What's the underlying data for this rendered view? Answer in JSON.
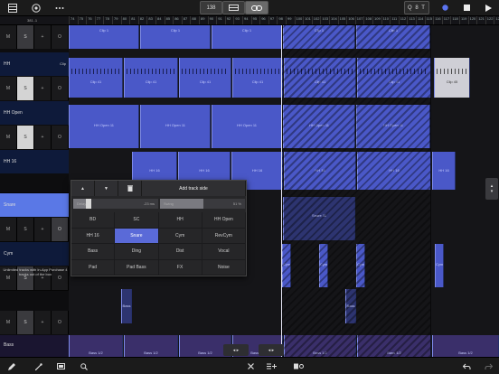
{
  "topbar": {
    "tempo": "138",
    "quantize_label": "Q 8 T",
    "icons": [
      "grid-icon",
      "dial-icon",
      "more-icon",
      "loop-view-icon",
      "link-icon",
      "record-icon",
      "stop-icon",
      "play-icon"
    ]
  },
  "ruler": {
    "position": "381..1",
    "bars": [
      "74",
      "75",
      "76",
      "77",
      "78",
      "79",
      "80",
      "81",
      "82",
      "83",
      "84",
      "85",
      "86",
      "87",
      "88",
      "89",
      "90",
      "91",
      "92",
      "93",
      "94",
      "95",
      "96",
      "97",
      "98",
      "99",
      "100",
      "101",
      "102",
      "103",
      "104",
      "105",
      "106",
      "107",
      "108",
      "109",
      "110",
      "111",
      "112",
      "113",
      "114",
      "115",
      "116",
      "117",
      "118",
      "119",
      "120",
      "121",
      "122",
      "123"
    ]
  },
  "tracks": [
    {
      "name": "",
      "clip_label": "",
      "mute": "M",
      "solo": "S",
      "add": "+",
      "power": "O"
    },
    {
      "name": "HH",
      "clip_label": "Clip",
      "mute": "M",
      "solo": "S",
      "add": "+",
      "power": "O"
    },
    {
      "name": "HH Open",
      "clip_label": "",
      "mute": "M",
      "solo": "S",
      "add": "+",
      "power": "O"
    },
    {
      "name": "HH 16",
      "clip_label": "",
      "mute": "M",
      "solo": "S",
      "add": "+",
      "power": "O"
    },
    {
      "name": "Snare",
      "clip_label": "",
      "mute": "M",
      "solo": "S",
      "add": "+",
      "power": "O"
    },
    {
      "name": "Cym",
      "clip_label": "",
      "mute": "M",
      "solo": "S",
      "add": "+",
      "power": "O"
    },
    {
      "name": "",
      "clip_label": "",
      "mute": "M",
      "solo": "S",
      "add": "+",
      "power": "O"
    },
    {
      "name": "Bass",
      "clip_label": "",
      "mute": "M",
      "solo": "S",
      "add": "+",
      "power": "O"
    }
  ],
  "info_text": "Unlimited tracks with In-App Purchase 4 tracks out of the box",
  "clips": {
    "row0": [
      "Clip 1",
      "Clip 1",
      "Clip 1",
      "Clip 1",
      "Clip 1"
    ],
    "hh": [
      "Clip 41",
      "Clip 41",
      "Clip 41",
      "Clip 41",
      "Clip 41",
      "Clip 41",
      "Clip 45"
    ],
    "hh_open": [
      "HH Open 11",
      "HH Open 11",
      "HH Open 11",
      "HH Open 11",
      "HH Open 11"
    ],
    "hh16": [
      "HH 16",
      "HH 16",
      "HH 16",
      "HH 16",
      "HH 16",
      "HH 16"
    ],
    "snare": "Snare 11",
    "cym": [
      "Cym",
      "Cym",
      "Cym",
      "Cym"
    ],
    "bass_small": [
      "Bass",
      "Bass"
    ],
    "bass": [
      "Bass 1/2",
      "Bass 1/2",
      "Bass 1/2",
      "Bass 1/2",
      "Bass 1/2",
      "Bass 1/2",
      "Bass 1/2"
    ]
  },
  "popup": {
    "up": "▲",
    "down": "▼",
    "title": "Add track side",
    "delay_label": "Delay",
    "delay_value": "-23 ms",
    "delay_fraction": 0.15,
    "swing_label": "Swing",
    "swing_value": "51 %",
    "swing_fraction": 0.51,
    "grid": [
      [
        "BD",
        "SC",
        "HH",
        "HH Open"
      ],
      [
        "HH 16",
        "Snare",
        "Cym",
        "RevCym"
      ],
      [
        "Bass",
        "Ding",
        "Dist",
        "Vocal"
      ],
      [
        "Pad",
        "Pad Bass",
        "FX",
        "Noise"
      ]
    ],
    "active": "Snare"
  },
  "bottombar": {
    "icons": [
      "pencil-icon",
      "magic-wand-icon",
      "clip-view-icon",
      "zoom-icon",
      "close-icon",
      "add-track-icon",
      "clip-settings-icon",
      "undo-icon",
      "redo-icon"
    ],
    "nav_left": "◂ ▸",
    "nav_right": "◂ ▸"
  },
  "colors": {
    "clip": "#4a58c8",
    "clip_dark": "#2d3470",
    "selected_track": "#5a78e6",
    "active_cell": "#5a6ad8",
    "background": "#151518"
  }
}
